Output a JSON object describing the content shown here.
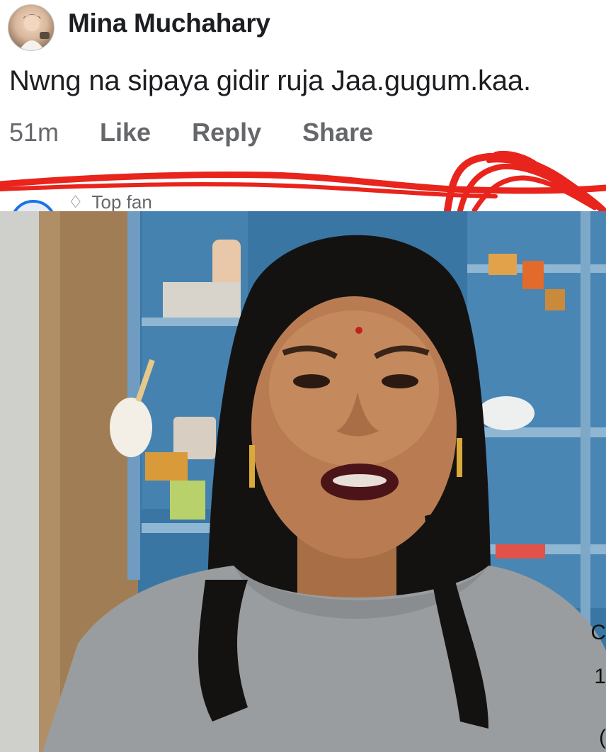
{
  "comment": {
    "author": "Mina Muchahary",
    "text": "Nwng na sipaya gidir ruja Jaa.gugum.kaa.",
    "timestamp": "51m",
    "actions": [
      "Like",
      "Reply",
      "Share"
    ]
  },
  "next_comment": {
    "badge_icon": "diamond-icon",
    "badge_label": "Top fan"
  },
  "video": {
    "edge_glyphs": [
      "C",
      "1",
      "("
    ]
  },
  "colors": {
    "text_primary": "#1c1e21",
    "text_secondary": "#65676b",
    "scribble_red": "#e8241c",
    "shelf_blue": "#3f7fb0",
    "shirt_gray": "#9a9d9f"
  }
}
